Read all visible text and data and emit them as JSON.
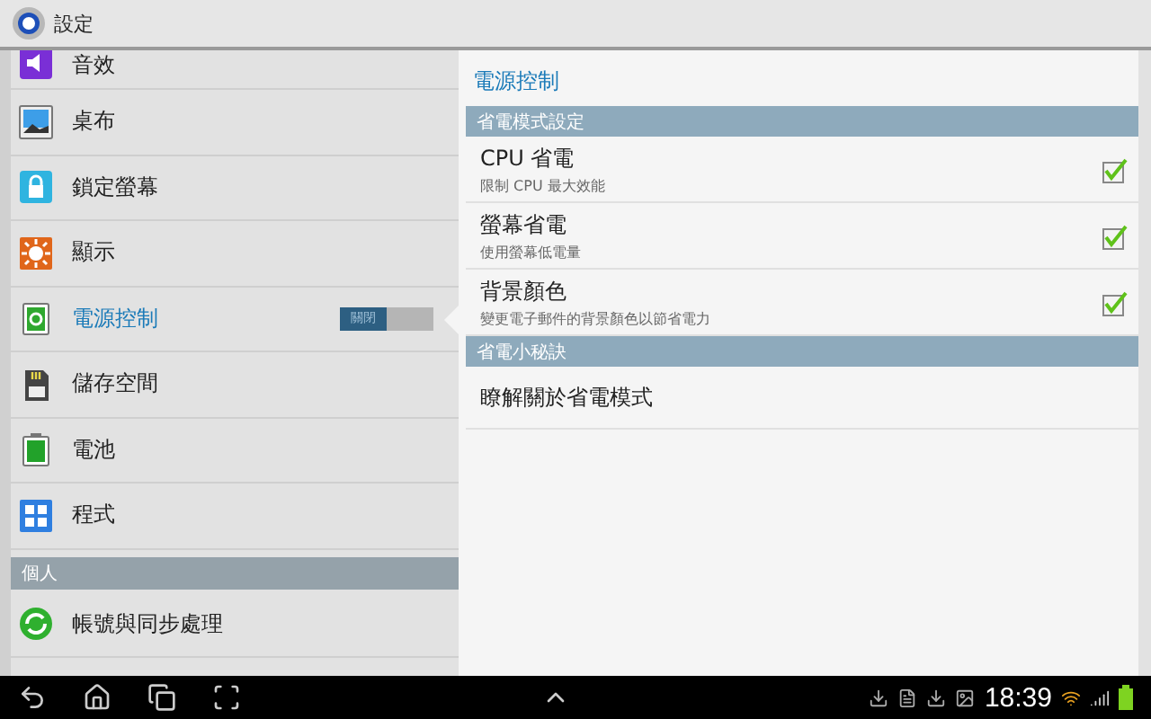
{
  "title_bar": {
    "title": "設定"
  },
  "sidebar": {
    "items": [
      {
        "kind": "item",
        "label": "音效",
        "selected": false
      },
      {
        "kind": "item",
        "label": "桌布",
        "selected": false
      },
      {
        "kind": "item",
        "label": "鎖定螢幕",
        "selected": false
      },
      {
        "kind": "item",
        "label": "顯示",
        "selected": false
      },
      {
        "kind": "item",
        "label": "電源控制",
        "selected": true,
        "toggle": {
          "label": "關閉",
          "on": false
        }
      },
      {
        "kind": "item",
        "label": "儲存空間",
        "selected": false
      },
      {
        "kind": "item",
        "label": "電池",
        "selected": false
      },
      {
        "kind": "item",
        "label": "程式",
        "selected": false
      },
      {
        "kind": "header",
        "label": "個人"
      },
      {
        "kind": "item",
        "label": "帳號與同步處理",
        "selected": false
      }
    ]
  },
  "detail": {
    "title": "電源控制",
    "sections": [
      {
        "header": "省電模式設定",
        "rows": [
          {
            "title": "CPU 省電",
            "summary": "限制 CPU 最大效能",
            "checked": true
          },
          {
            "title": "螢幕省電",
            "summary": "使用螢幕低電量",
            "checked": true
          },
          {
            "title": "背景顏色",
            "summary": "變更電子郵件的背景顏色以節省電力",
            "checked": true
          }
        ]
      },
      {
        "header": "省電小秘訣",
        "rows": [
          {
            "title": "瞭解關於省電模式"
          }
        ]
      }
    ]
  },
  "status_bar": {
    "time": "18:39"
  }
}
